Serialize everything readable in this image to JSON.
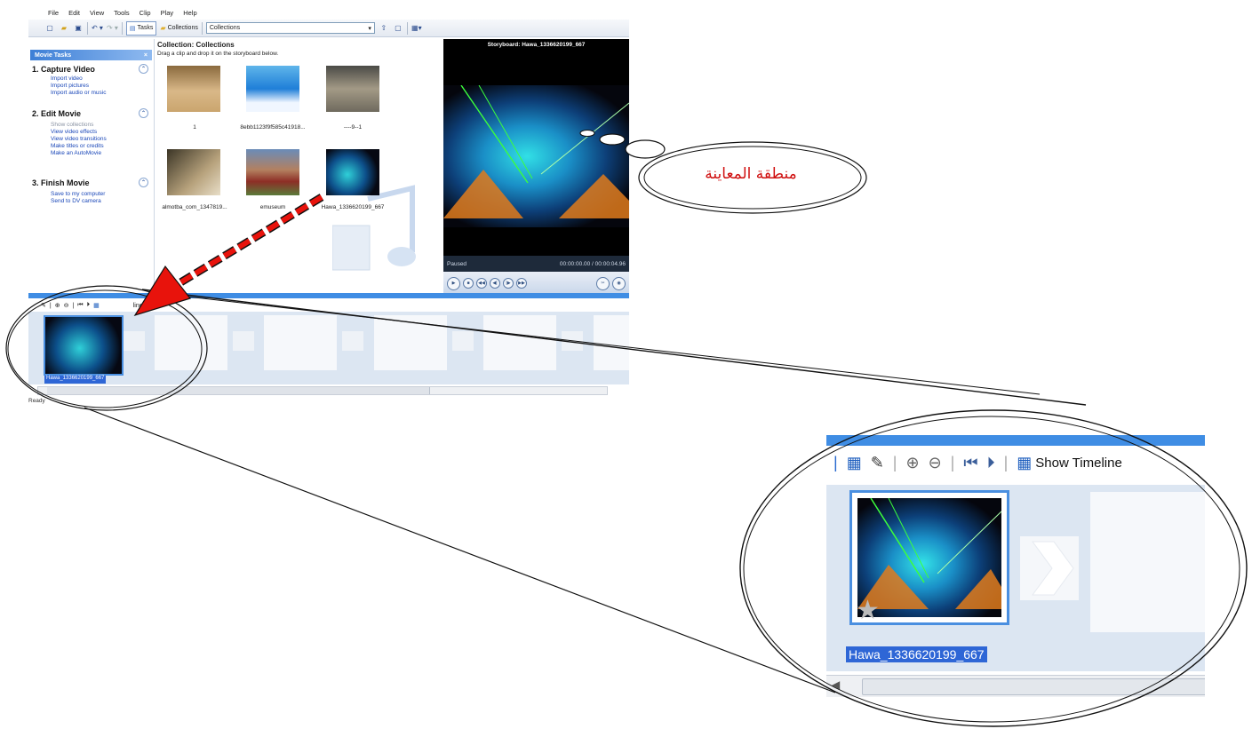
{
  "menu": [
    "File",
    "Edit",
    "View",
    "Tools",
    "Clip",
    "Play",
    "Help"
  ],
  "toolbar": {
    "tasks_label": "Tasks",
    "collections_label": "Collections",
    "collections_select": "Collections"
  },
  "task_pane": {
    "header": "Movie Tasks",
    "close": "×",
    "sections": [
      {
        "title": "1. Capture Video",
        "links": [
          "Import video",
          "Import pictures",
          "Import audio or music"
        ]
      },
      {
        "title": "2. Edit Movie",
        "links": [
          "Show collections",
          "View video effects",
          "View video transitions",
          "Make titles or credits",
          "Make an AutoMovie"
        ]
      },
      {
        "title": "3. Finish Movie",
        "links": [
          "Save to my computer",
          "Send to DV camera"
        ]
      }
    ]
  },
  "collection": {
    "title": "Collection: Collections",
    "hint": "Drag a clip and drop it on the storyboard below.",
    "items": [
      {
        "caption": "1"
      },
      {
        "caption": "8ebb1123f9f585c41918..."
      },
      {
        "caption": "----9--1"
      },
      {
        "caption": "almotba_com_1347819..."
      },
      {
        "caption": "emuseum"
      },
      {
        "caption": "Hawa_1336620199_667"
      }
    ]
  },
  "preview": {
    "title": "Storyboard: Hawa_1336620199_667",
    "status": "Paused",
    "time": "00:00:00.00 / 00:00:04.96"
  },
  "storyboard": {
    "toolbar_label": "Show Timeline",
    "toolbar_label_partial": "line",
    "clip_label": "Hawa_1336620199_667",
    "status": "Ready"
  },
  "callout": {
    "text": "منطقة المعاينة"
  },
  "colors": {
    "accent": "#3f8de4",
    "arrow": "#e8130c",
    "callout_text": "#d01010"
  }
}
